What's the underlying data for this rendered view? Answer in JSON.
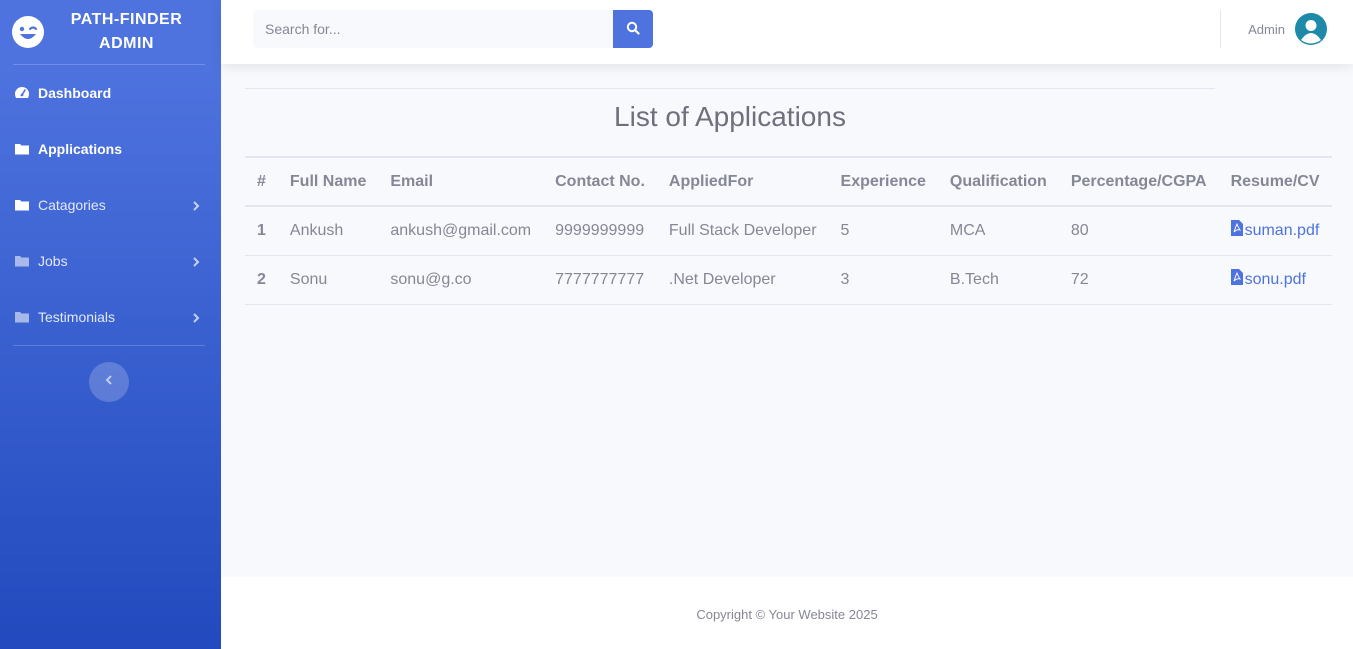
{
  "brand": {
    "line1": "PATH-FINDER",
    "line2": "ADMIN",
    "icon": "laugh-wink-icon"
  },
  "sidebar": {
    "items": [
      {
        "label": "Dashboard",
        "icon": "tachometer-icon"
      },
      {
        "label": "Applications",
        "icon": "folder-icon"
      },
      {
        "label": "Catagories",
        "icon": "folder-icon"
      },
      {
        "label": "Jobs",
        "icon": "folder-icon"
      },
      {
        "label": "Testimonials",
        "icon": "folder-icon"
      }
    ],
    "toggle_icon": "chevron-left-icon"
  },
  "search": {
    "placeholder": "Search for...",
    "icon": "search-icon"
  },
  "user": {
    "name": "Admin",
    "icon": "user-avatar-icon"
  },
  "page": {
    "title": "List of Applications"
  },
  "table": {
    "headers": [
      "#",
      "Full Name",
      "Email",
      "Contact No.",
      "AppliedFor",
      "Experience",
      "Qualification",
      "Percentage/CGPA",
      "Resume/CV"
    ],
    "rows": [
      {
        "num": "1",
        "name": "Ankush",
        "email": "ankush@gmail.com",
        "contact": "9999999999",
        "applied": "Full Stack Developer",
        "experience": "5",
        "qualification": "MCA",
        "percentage": "80",
        "resume": "suman.pdf"
      },
      {
        "num": "2",
        "name": "Sonu",
        "email": "sonu@g.co",
        "contact": "7777777777",
        "applied": ".Net Developer",
        "experience": "3",
        "qualification": "B.Tech",
        "percentage": "72",
        "resume": "sonu.pdf"
      }
    ]
  },
  "footer": {
    "text": "Copyright © Your Website 2025"
  },
  "colors": {
    "primary": "#4e73df",
    "sidebar_end": "#224abe",
    "text_muted": "#858796"
  }
}
